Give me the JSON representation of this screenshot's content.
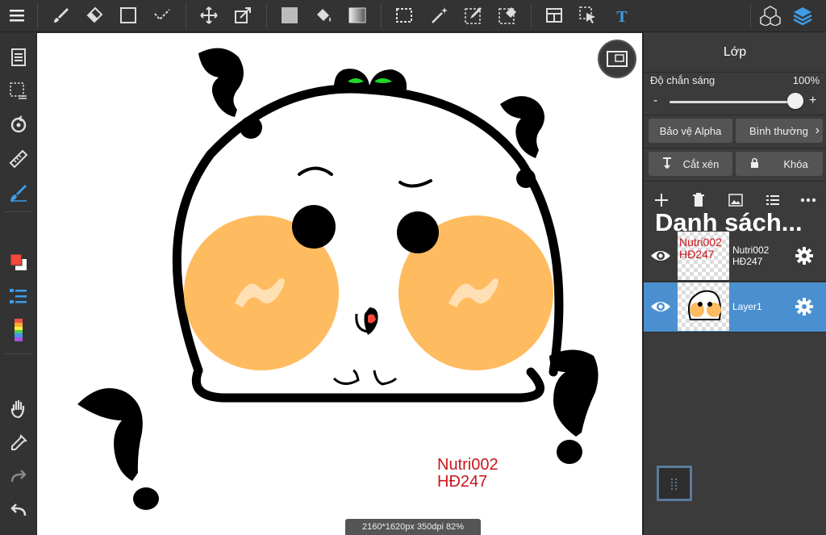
{
  "toolbar": {
    "tools": [
      "menu-icon",
      "brush-icon",
      "eraser-icon",
      "rectangle-icon",
      "dot-brush-icon",
      "move-icon",
      "transform-icon",
      "fill-color-icon",
      "bucket-icon",
      "gradient-icon",
      "select-rect-icon",
      "magic-wand-icon",
      "select-pen-icon",
      "select-eraser-icon",
      "layout-icon",
      "select-layer-icon",
      "text-icon",
      "3d-material-icon",
      "layers-icon"
    ]
  },
  "left_tools": [
    "page-manager-icon",
    "selection-icon",
    "rotate-icon",
    "ruler-icon",
    "pen-icon",
    "color-swatch-icon",
    "layer-list-icon",
    "color-bar-icon",
    "hand-icon",
    "eyedropper-icon",
    "redo-icon",
    "undo-icon"
  ],
  "colors": {
    "foreground": "#f5473a",
    "accent": "#4a90d0"
  },
  "canvas": {
    "watermark_line1": "Nutri002",
    "watermark_line2": "HĐ247",
    "status": "2160*1620px 350dpi 82%"
  },
  "panel": {
    "title": "Lớp",
    "opacity_label": "Độ chắn sáng",
    "opacity_value": "100%",
    "opacity_percent": 100,
    "alpha_protect": "Bảo vệ Alpha",
    "blend_mode": "Bình thường",
    "clipping": "Cắt xén",
    "lock": "Khóa",
    "list_heading": "Danh sách...",
    "layers": [
      {
        "name_line1": "Nutri002",
        "name_line2": "HĐ247",
        "thumb_line1": "Nutri002",
        "thumb_line2": "HĐ247",
        "visible": true,
        "selected": false
      },
      {
        "name_line1": "Layer1",
        "name_line2": "",
        "visible": true,
        "selected": true
      }
    ]
  }
}
